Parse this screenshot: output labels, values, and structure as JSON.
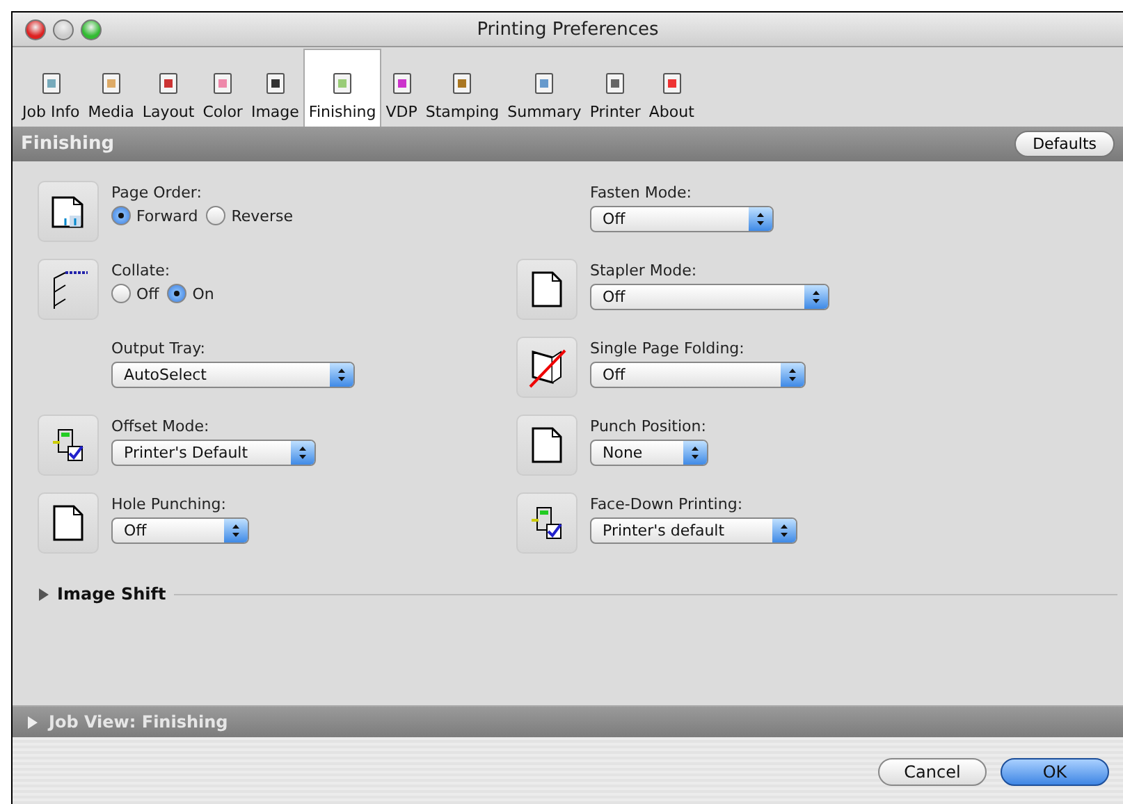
{
  "window": {
    "title": "Printing Preferences"
  },
  "tabs": [
    {
      "label": "Job Info",
      "selected": false
    },
    {
      "label": "Media",
      "selected": false
    },
    {
      "label": "Layout",
      "selected": false
    },
    {
      "label": "Color",
      "selected": false
    },
    {
      "label": "Image",
      "selected": false
    },
    {
      "label": "Finishing",
      "selected": true
    },
    {
      "label": "VDP",
      "selected": false
    },
    {
      "label": "Stamping",
      "selected": false
    },
    {
      "label": "Summary",
      "selected": false
    },
    {
      "label": "Printer",
      "selected": false
    },
    {
      "label": "About",
      "selected": false
    }
  ],
  "section": {
    "title": "Finishing",
    "defaults_button": "Defaults"
  },
  "left_column": [
    {
      "kind": "radio",
      "label": "Page Order:",
      "options": [
        {
          "label": "Forward",
          "selected": true
        },
        {
          "label": "Reverse",
          "selected": false
        }
      ]
    },
    {
      "kind": "radio",
      "label": "Collate:",
      "options": [
        {
          "label": "Off",
          "selected": false
        },
        {
          "label": "On",
          "selected": true
        }
      ]
    },
    {
      "kind": "select",
      "label": "Output Tray:",
      "value": "AutoSelect"
    },
    {
      "kind": "select",
      "label": "Offset Mode:",
      "value": "Printer's Default"
    },
    {
      "kind": "select",
      "label": "Hole Punching:",
      "value": "Off"
    }
  ],
  "right_column": [
    {
      "kind": "select",
      "label": "Fasten Mode:",
      "value": "Off"
    },
    {
      "kind": "select",
      "label": "Stapler Mode:",
      "value": "Off"
    },
    {
      "kind": "select",
      "label": "Single Page Folding:",
      "value": "Off"
    },
    {
      "kind": "select",
      "label": "Punch Position:",
      "value": "None"
    },
    {
      "kind": "select",
      "label": "Face-Down Printing:",
      "value": "Printer's default"
    }
  ],
  "image_shift": {
    "label": "Image Shift",
    "expanded": false
  },
  "job_view": {
    "label": "Job View: Finishing",
    "expanded": false
  },
  "buttons": [
    {
      "label": "Cancel",
      "kind": "normal"
    },
    {
      "label": "OK",
      "kind": "default"
    }
  ]
}
